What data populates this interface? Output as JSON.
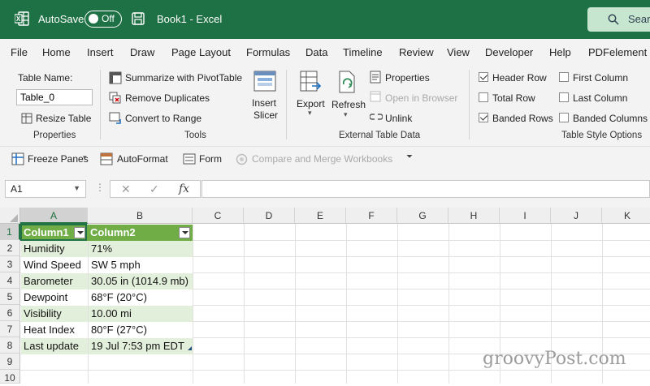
{
  "titlebar": {
    "autosave_label": "AutoSave",
    "autosave_state": "Off",
    "title": "Book1  -  Excel",
    "search_placeholder": "Sear",
    "bg_color": "#1e7145"
  },
  "menu": {
    "items": [
      "File",
      "Home",
      "Insert",
      "Draw",
      "Page Layout",
      "Formulas",
      "Data",
      "Timeline",
      "Review",
      "View",
      "Developer",
      "Help",
      "PDFelement"
    ]
  },
  "ribbon": {
    "properties": {
      "table_name_label": "Table Name:",
      "table_name_value": "Table_0",
      "resize_table": "Resize Table",
      "group": "Properties"
    },
    "tools": {
      "summarize": "Summarize with PivotTable",
      "remove_duplicates": "Remove Duplicates",
      "convert_to_range": "Convert to Range",
      "insert_slicer": "Insert Slicer",
      "insert_slicer_l1": "Insert",
      "insert_slicer_l2": "Slicer",
      "group": "Tools"
    },
    "external": {
      "export": "Export",
      "refresh": "Refresh",
      "properties": "Properties",
      "open_in_browser": "Open in Browser",
      "unlink": "Unlink",
      "group": "External Table Data"
    },
    "style_options": {
      "header_row": {
        "label": "Header Row",
        "checked": true
      },
      "total_row": {
        "label": "Total Row",
        "checked": false
      },
      "banded_rows": {
        "label": "Banded Rows",
        "checked": true
      },
      "first_column": {
        "label": "First Column",
        "checked": false
      },
      "last_column": {
        "label": "Last Column",
        "checked": false
      },
      "banded_columns": {
        "label": "Banded Columns",
        "checked": false
      },
      "group": "Table Style Options"
    }
  },
  "quickbar": {
    "freeze_panes": "Freeze Panes",
    "autoformat": "AutoFormat",
    "form": "Form",
    "compare_merge": "Compare and Merge Workbooks"
  },
  "formula_bar": {
    "name_box": "A1",
    "fx": "fx",
    "value": ""
  },
  "grid": {
    "columns": [
      "A",
      "B",
      "C",
      "D",
      "E",
      "F",
      "G",
      "H",
      "I",
      "J",
      "K"
    ],
    "rows": [
      "1",
      "2",
      "3",
      "4",
      "5",
      "6",
      "7",
      "8",
      "9",
      "10"
    ],
    "selected_cell": "A1",
    "table": {
      "header": [
        "Column1",
        "Column2"
      ],
      "rows": [
        [
          "Humidity",
          "71%"
        ],
        [
          "Wind Speed",
          "SW 5 mph"
        ],
        [
          "Barometer",
          "30.05 in (1014.9 mb)"
        ],
        [
          "Dewpoint",
          "68°F (20°C)"
        ],
        [
          "Visibility",
          "10.00 mi"
        ],
        [
          "Heat Index",
          "80°F (27°C)"
        ],
        [
          "Last update",
          "19 Jul 7:53 pm EDT"
        ]
      ],
      "header_color": "#70ad47",
      "band_color": "#e2efda"
    }
  },
  "watermark": "groovyPost.com"
}
